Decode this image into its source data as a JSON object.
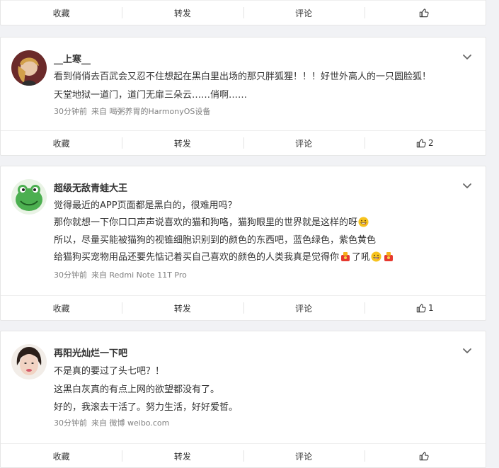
{
  "actions": {
    "collect": "收藏",
    "repost": "转发",
    "comment": "评论"
  },
  "top_card": {
    "like_count": ""
  },
  "posts": [
    {
      "username": "__上寒__",
      "lines": [
        "看到俏俏去百武会又忍不住想起在黑白里出场的那只胖狐狸！！！好世外高人的一只圆脸狐！",
        "天堂地狱一道门，道门无扉三朵云……俏啊……"
      ],
      "time": "30分钟前",
      "source": "来自 喝粥养胃的HarmonyOS设备",
      "like_count": "2"
    },
    {
      "username": "超级无敌青蛙大王",
      "lines": [
        "觉得最近的APP页面都是黑白的，很难用吗？",
        "那你就想一下你口口声声说喜欢的猫和狗咯，猫狗眼里的世界就是这样的呀",
        "所以，尽量买能被猫狗的视锥细胞识别到的颜色的东西吧，蓝色绿色，紫色黄色",
        "给猫狗买宠物用品还要先惦记着买自己喜欢的颜色的人类我真是觉得你",
        "了吼"
      ],
      "time": "30分钟前",
      "source": "来自 Redmi Note 11T Pro",
      "like_count": "1"
    },
    {
      "username": "再阳光灿烂一下吧",
      "lines": [
        "不是真的要过了头七吧？！",
        "这黑白灰真的有点上网的欲望都没有了。",
        "好的，我滚去干活了。努力生活，好好爱哲。"
      ],
      "time": "30分钟前",
      "source": "来自 微博 weibo.com",
      "like_count": ""
    }
  ]
}
